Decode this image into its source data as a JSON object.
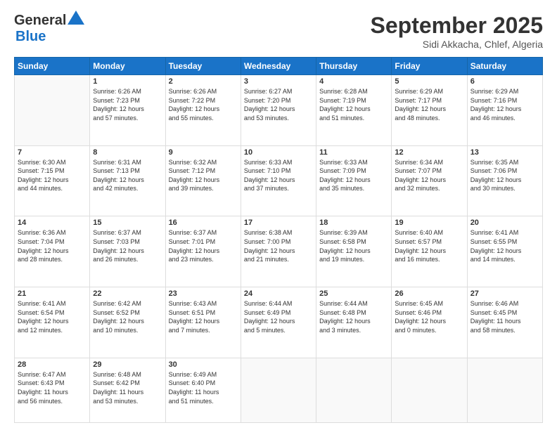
{
  "logo": {
    "line1": "General",
    "line2": "Blue"
  },
  "title": "September 2025",
  "location": "Sidi Akkacha, Chlef, Algeria",
  "days_header": [
    "Sunday",
    "Monday",
    "Tuesday",
    "Wednesday",
    "Thursday",
    "Friday",
    "Saturday"
  ],
  "weeks": [
    [
      {
        "num": "",
        "info": ""
      },
      {
        "num": "1",
        "info": "Sunrise: 6:26 AM\nSunset: 7:23 PM\nDaylight: 12 hours\nand 57 minutes."
      },
      {
        "num": "2",
        "info": "Sunrise: 6:26 AM\nSunset: 7:22 PM\nDaylight: 12 hours\nand 55 minutes."
      },
      {
        "num": "3",
        "info": "Sunrise: 6:27 AM\nSunset: 7:20 PM\nDaylight: 12 hours\nand 53 minutes."
      },
      {
        "num": "4",
        "info": "Sunrise: 6:28 AM\nSunset: 7:19 PM\nDaylight: 12 hours\nand 51 minutes."
      },
      {
        "num": "5",
        "info": "Sunrise: 6:29 AM\nSunset: 7:17 PM\nDaylight: 12 hours\nand 48 minutes."
      },
      {
        "num": "6",
        "info": "Sunrise: 6:29 AM\nSunset: 7:16 PM\nDaylight: 12 hours\nand 46 minutes."
      }
    ],
    [
      {
        "num": "7",
        "info": "Sunrise: 6:30 AM\nSunset: 7:15 PM\nDaylight: 12 hours\nand 44 minutes."
      },
      {
        "num": "8",
        "info": "Sunrise: 6:31 AM\nSunset: 7:13 PM\nDaylight: 12 hours\nand 42 minutes."
      },
      {
        "num": "9",
        "info": "Sunrise: 6:32 AM\nSunset: 7:12 PM\nDaylight: 12 hours\nand 39 minutes."
      },
      {
        "num": "10",
        "info": "Sunrise: 6:33 AM\nSunset: 7:10 PM\nDaylight: 12 hours\nand 37 minutes."
      },
      {
        "num": "11",
        "info": "Sunrise: 6:33 AM\nSunset: 7:09 PM\nDaylight: 12 hours\nand 35 minutes."
      },
      {
        "num": "12",
        "info": "Sunrise: 6:34 AM\nSunset: 7:07 PM\nDaylight: 12 hours\nand 32 minutes."
      },
      {
        "num": "13",
        "info": "Sunrise: 6:35 AM\nSunset: 7:06 PM\nDaylight: 12 hours\nand 30 minutes."
      }
    ],
    [
      {
        "num": "14",
        "info": "Sunrise: 6:36 AM\nSunset: 7:04 PM\nDaylight: 12 hours\nand 28 minutes."
      },
      {
        "num": "15",
        "info": "Sunrise: 6:37 AM\nSunset: 7:03 PM\nDaylight: 12 hours\nand 26 minutes."
      },
      {
        "num": "16",
        "info": "Sunrise: 6:37 AM\nSunset: 7:01 PM\nDaylight: 12 hours\nand 23 minutes."
      },
      {
        "num": "17",
        "info": "Sunrise: 6:38 AM\nSunset: 7:00 PM\nDaylight: 12 hours\nand 21 minutes."
      },
      {
        "num": "18",
        "info": "Sunrise: 6:39 AM\nSunset: 6:58 PM\nDaylight: 12 hours\nand 19 minutes."
      },
      {
        "num": "19",
        "info": "Sunrise: 6:40 AM\nSunset: 6:57 PM\nDaylight: 12 hours\nand 16 minutes."
      },
      {
        "num": "20",
        "info": "Sunrise: 6:41 AM\nSunset: 6:55 PM\nDaylight: 12 hours\nand 14 minutes."
      }
    ],
    [
      {
        "num": "21",
        "info": "Sunrise: 6:41 AM\nSunset: 6:54 PM\nDaylight: 12 hours\nand 12 minutes."
      },
      {
        "num": "22",
        "info": "Sunrise: 6:42 AM\nSunset: 6:52 PM\nDaylight: 12 hours\nand 10 minutes."
      },
      {
        "num": "23",
        "info": "Sunrise: 6:43 AM\nSunset: 6:51 PM\nDaylight: 12 hours\nand 7 minutes."
      },
      {
        "num": "24",
        "info": "Sunrise: 6:44 AM\nSunset: 6:49 PM\nDaylight: 12 hours\nand 5 minutes."
      },
      {
        "num": "25",
        "info": "Sunrise: 6:44 AM\nSunset: 6:48 PM\nDaylight: 12 hours\nand 3 minutes."
      },
      {
        "num": "26",
        "info": "Sunrise: 6:45 AM\nSunset: 6:46 PM\nDaylight: 12 hours\nand 0 minutes."
      },
      {
        "num": "27",
        "info": "Sunrise: 6:46 AM\nSunset: 6:45 PM\nDaylight: 11 hours\nand 58 minutes."
      }
    ],
    [
      {
        "num": "28",
        "info": "Sunrise: 6:47 AM\nSunset: 6:43 PM\nDaylight: 11 hours\nand 56 minutes."
      },
      {
        "num": "29",
        "info": "Sunrise: 6:48 AM\nSunset: 6:42 PM\nDaylight: 11 hours\nand 53 minutes."
      },
      {
        "num": "30",
        "info": "Sunrise: 6:49 AM\nSunset: 6:40 PM\nDaylight: 11 hours\nand 51 minutes."
      },
      {
        "num": "",
        "info": ""
      },
      {
        "num": "",
        "info": ""
      },
      {
        "num": "",
        "info": ""
      },
      {
        "num": "",
        "info": ""
      }
    ]
  ]
}
